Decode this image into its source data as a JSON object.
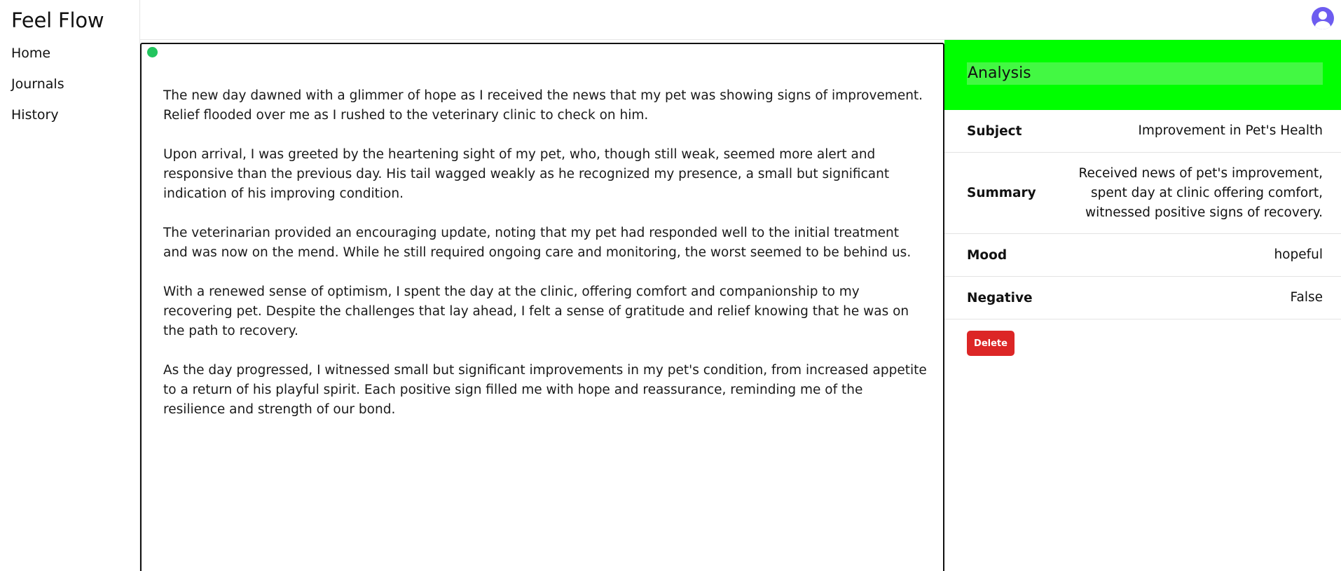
{
  "app": {
    "title": "Feel Flow"
  },
  "nav": {
    "items": [
      {
        "label": "Home"
      },
      {
        "label": "Journals"
      },
      {
        "label": "History"
      }
    ]
  },
  "editor": {
    "paragraphs": [
      "The new day dawned with a glimmer of hope as I received the news that my pet was showing signs of improvement. Relief flooded over me as I rushed to the veterinary clinic to check on him.",
      "Upon arrival, I was greeted by the heartening sight of my pet, who, though still weak, seemed more alert and responsive than the previous day. His tail wagged weakly as he recognized my presence, a small but significant indication of his improving condition.",
      "The veterinarian provided an encouraging update, noting that my pet had responded well to the initial treatment and was now on the mend. While he still required ongoing care and monitoring, the worst seemed to be behind us.",
      "With a renewed sense of optimism, I spent the day at the clinic, offering comfort and companionship to my recovering pet. Despite the challenges that lay ahead, I felt a sense of gratitude and relief knowing that he was on the path to recovery.",
      "As the day progressed, I witnessed small but significant improvements in my pet's condition, from increased appetite to a return of his playful spirit. Each positive sign filled me with hope and reassurance, reminding me of the resilience and strength of our bond."
    ]
  },
  "analysis": {
    "title": "Analysis",
    "header_color": "#00ff00",
    "fields": {
      "subject": {
        "label": "Subject",
        "value": "Improvement in Pet's Health"
      },
      "summary": {
        "label": "Summary",
        "value": "Received news of pet's improvement, spent day at clinic offering comfort, witnessed positive signs of recovery."
      },
      "mood": {
        "label": "Mood",
        "value": "hopeful"
      },
      "negative": {
        "label": "Negative",
        "value": "False"
      }
    },
    "delete_label": "Delete"
  },
  "icons": {
    "avatar": "user-avatar-icon",
    "status": "status-dot-icon"
  },
  "colors": {
    "status_dot": "#22c55e",
    "delete": "#dc2626",
    "avatar": "#6d5cf0"
  }
}
